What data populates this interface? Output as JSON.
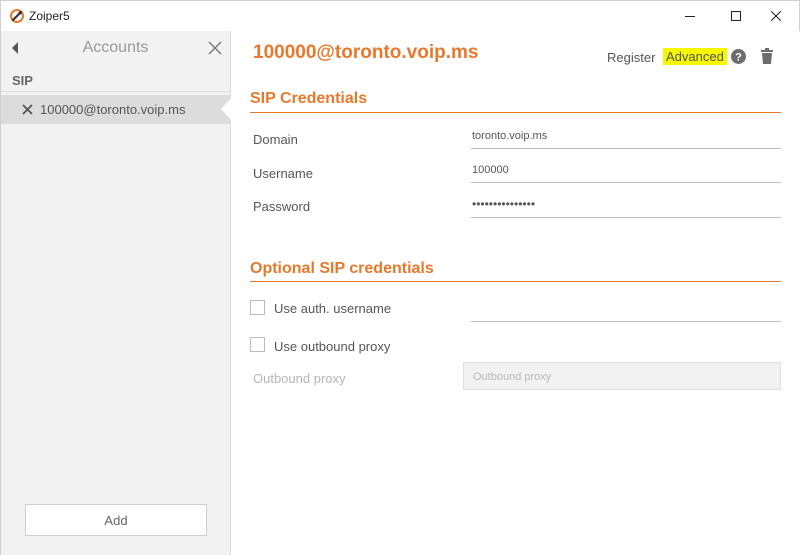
{
  "window": {
    "title": "Zoiper5",
    "controls": {
      "minimize": "minimize-icon",
      "maximize": "maximize-icon",
      "close": "close-icon"
    }
  },
  "sidebar": {
    "title": "Accounts",
    "section": "SIP",
    "accounts": [
      {
        "label": "100000@toronto.voip.ms",
        "selected": true
      }
    ],
    "add_label": "Add"
  },
  "main": {
    "account_title": "100000@toronto.voip.ms",
    "actions": {
      "register": "Register",
      "advanced": "Advanced"
    },
    "sip_credentials": {
      "title": "SIP Credentials",
      "fields": [
        {
          "label": "Domain",
          "value": "toronto.voip.ms"
        },
        {
          "label": "Username",
          "value": "100000"
        },
        {
          "label": "Password",
          "value": "•••••••••••••••"
        }
      ]
    },
    "optional": {
      "title": "Optional SIP credentials",
      "use_auth_username": {
        "label": "Use auth. username",
        "checked": false,
        "value": ""
      },
      "use_outbound_proxy": {
        "label": "Use outbound proxy",
        "checked": false
      },
      "outbound_proxy": {
        "label": "Outbound proxy",
        "placeholder": "Outbound proxy"
      }
    }
  },
  "colors": {
    "accent": "#e8792c",
    "highlight": "#f7f700",
    "sidebar_bg": "#f2f2f2",
    "selected_bg": "#dcdcdc"
  }
}
